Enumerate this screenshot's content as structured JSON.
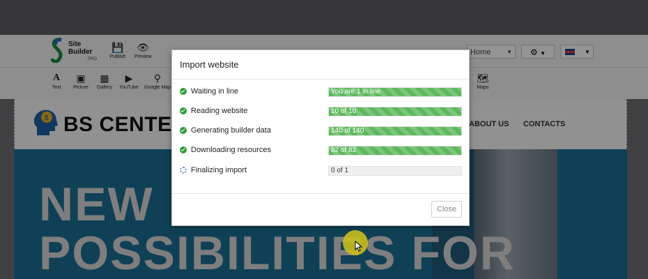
{
  "toolbar": {
    "logo_line1": "Site",
    "logo_line2": "Builder",
    "logo_pro": "PRO",
    "publish_label": "Publish",
    "preview_label": "Preview",
    "elements": [
      "Text",
      "Picture",
      "Gallery",
      "YouTube",
      "Google Map"
    ],
    "maps_label": "Maps",
    "page_select": "Home"
  },
  "site": {
    "brand": "BS CENTE",
    "nav": [
      "ABOUT US",
      "CONTACTS"
    ],
    "hero_line1": "NEW",
    "hero_line2": "POSSIBILITIES FOR"
  },
  "modal": {
    "title": "Import website",
    "steps": [
      {
        "name": "Waiting in line",
        "status": "You are 1 in line",
        "done": true,
        "progress": 1.0
      },
      {
        "name": "Reading website",
        "status": "10 of 10",
        "done": true,
        "progress": 1.0
      },
      {
        "name": "Generating builder data",
        "status": "140 of 140",
        "done": true,
        "progress": 1.0
      },
      {
        "name": "Downloading resources",
        "status": "82 of 82",
        "done": true,
        "progress": 1.0
      },
      {
        "name": "Finalizing import",
        "status": "0 of 1",
        "done": false,
        "progress": 0.0
      }
    ],
    "close_label": "Close"
  },
  "colors": {
    "success": "#5cb85c",
    "check": "#2f9b37",
    "hero_bg": "#1a6f94"
  }
}
